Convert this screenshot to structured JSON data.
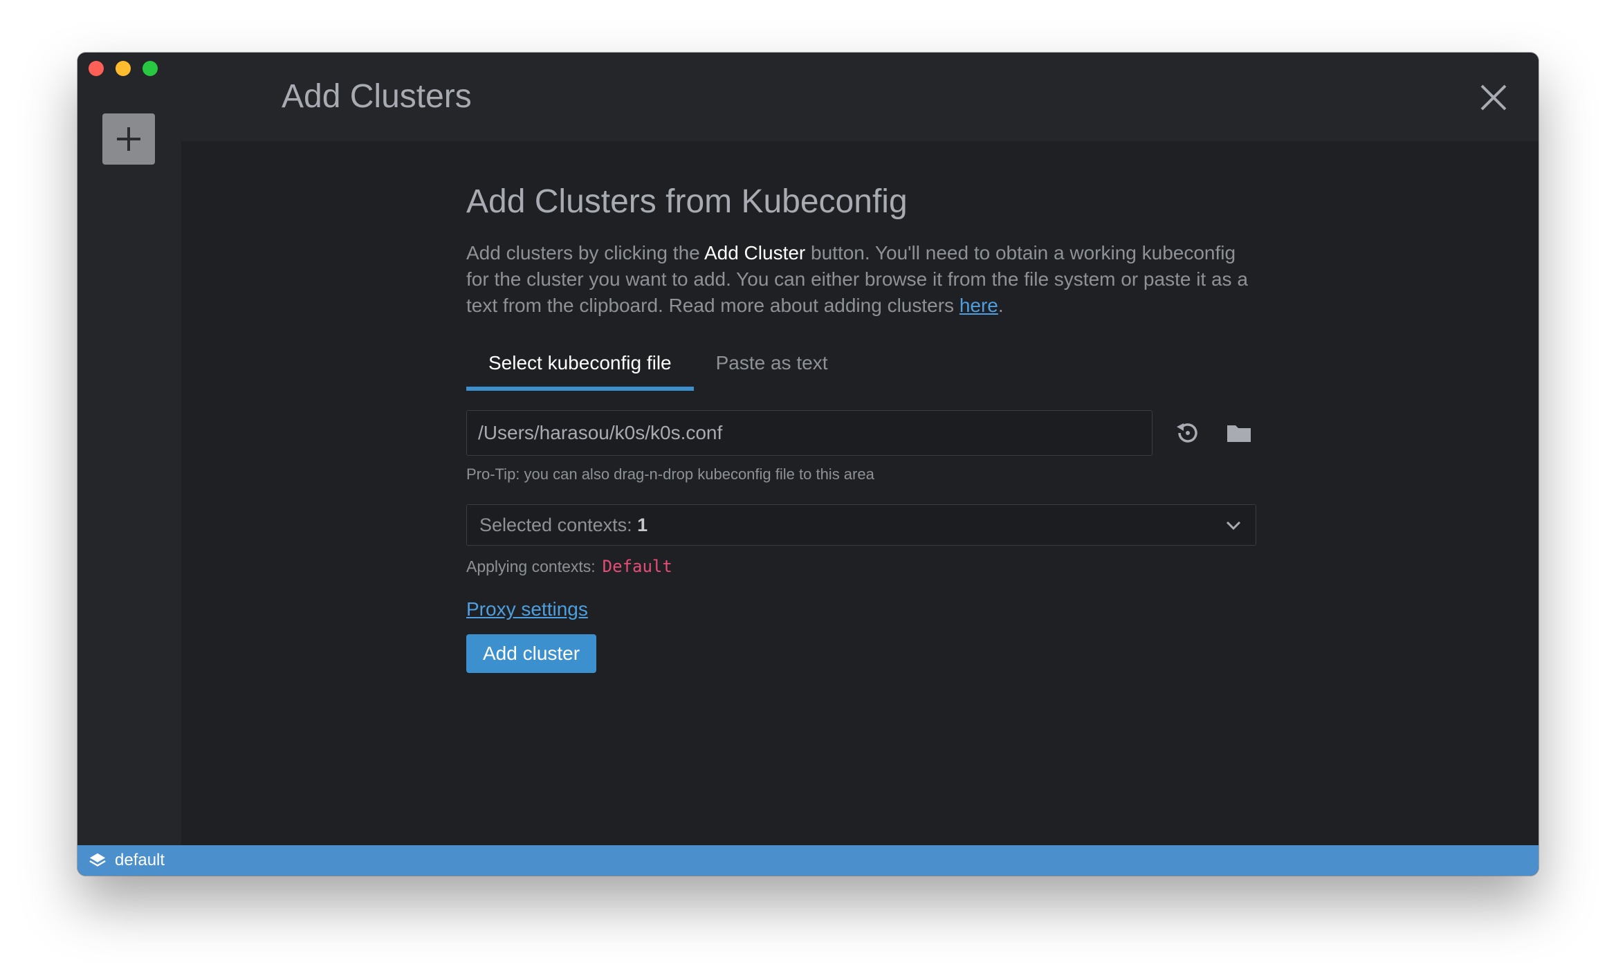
{
  "window": {
    "title": "Add Clusters"
  },
  "sidebar": {
    "add_icon": "plus-icon"
  },
  "main": {
    "heading": "Add Clusters from Kubeconfig",
    "description": {
      "part1": "Add clusters by clicking the ",
      "strong": "Add Cluster",
      "part2": " button. You'll need to obtain a working kubeconfig for the cluster you want to add. You can either browse it from the file system or paste it as a text from the clipboard. Read more about adding clusters ",
      "link": "here",
      "part3": "."
    },
    "tabs": [
      {
        "label": "Select kubeconfig file",
        "active": true
      },
      {
        "label": "Paste as text",
        "active": false
      }
    ],
    "file_path": "/Users/harasou/k0s/k0s.conf",
    "pro_tip": "Pro-Tip: you can also drag-n-drop kubeconfig file to this area",
    "contexts": {
      "label": "Selected contexts: ",
      "count": "1"
    },
    "applying": {
      "label": "Applying contexts:",
      "value": "Default"
    },
    "proxy_link": "Proxy settings",
    "add_button": "Add cluster"
  },
  "statusbar": {
    "icon": "layers-icon",
    "text": "default"
  },
  "colors": {
    "accent": "#3d90ce",
    "statusbar": "#4b8fcc",
    "context_value": "#e64e78",
    "link": "#4e9fe0"
  }
}
